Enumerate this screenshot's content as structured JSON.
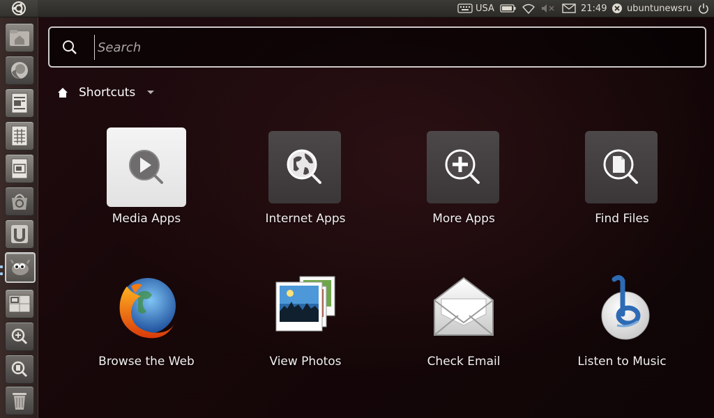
{
  "panel": {
    "keyboard_layout": "USA",
    "clock": "21:49",
    "username": "ubuntunewsru",
    "icons": [
      "ubuntu-logo-icon",
      "keyboard-icon",
      "battery-icon",
      "wifi-icon",
      "volume-muted-icon",
      "mail-icon",
      "user-status-icon",
      "power-icon"
    ]
  },
  "launcher": {
    "items": [
      "home-folder",
      "firefox",
      "writer",
      "calc",
      "impress",
      "ubuntu-software-center",
      "ubuntu-one",
      "gimp",
      "workspaces",
      "apps-lens",
      "files-lens",
      "trash"
    ]
  },
  "dash": {
    "search": {
      "placeholder": "Search",
      "value": ""
    },
    "filter": {
      "label": "Shortcuts"
    },
    "shortcuts": [
      {
        "label": "Media Apps",
        "icon": "media-play-icon",
        "active": true
      },
      {
        "label": "Internet Apps",
        "icon": "globe-search-icon"
      },
      {
        "label": "More Apps",
        "icon": "plus-search-icon"
      },
      {
        "label": "Find Files",
        "icon": "file-search-icon"
      },
      {
        "label": "Browse the Web",
        "icon": "firefox-icon"
      },
      {
        "label": "View Photos",
        "icon": "photos-icon"
      },
      {
        "label": "Check Email",
        "icon": "envelope-icon"
      },
      {
        "label": "Listen to Music",
        "icon": "banshee-icon"
      }
    ]
  },
  "colors": {
    "accent": "#dd4814",
    "launcher_indicator": "#9ccbf0"
  }
}
